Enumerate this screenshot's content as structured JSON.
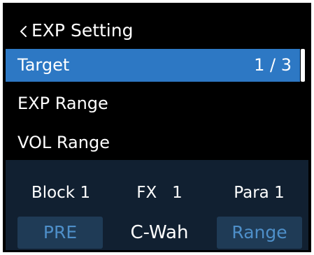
{
  "header": {
    "back_icon": "chevron-left-icon",
    "title": "EXP Setting"
  },
  "menu": {
    "items": [
      {
        "label": "Target",
        "value": "1 / 3",
        "selected": true
      },
      {
        "label": "EXP Range",
        "value": "",
        "selected": false
      },
      {
        "label": "VOL Range",
        "value": "",
        "selected": false
      }
    ]
  },
  "info": {
    "block": "Block 1",
    "fx": "FX   1",
    "para": "Para 1"
  },
  "footer": {
    "pre_label": "PRE",
    "fx_name": "C-Wah",
    "range_label": "Range"
  },
  "colors": {
    "selected_row": "#2d78c4",
    "panel_bg": "#112031",
    "button_bg": "#1f3b56",
    "button_text": "#4e8fc9"
  }
}
